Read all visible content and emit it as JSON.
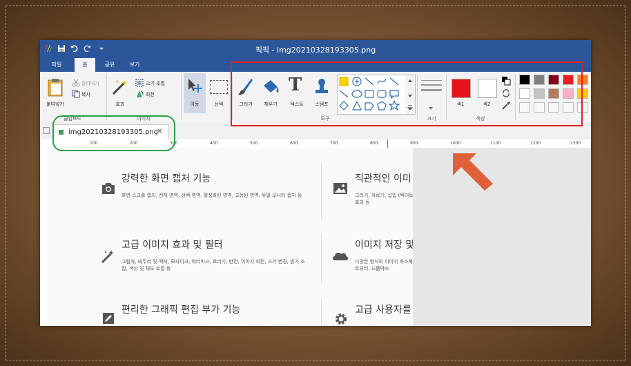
{
  "window": {
    "title": "픽픽 - img20210328193305.png"
  },
  "menu_tabs": [
    "파일",
    "홈",
    "공유",
    "보기"
  ],
  "ribbon": {
    "paste_label": "붙여넣기",
    "cut_label": "잘라내기",
    "copy_label": "복사",
    "effects_label": "효과",
    "resize_label": "크기 조절",
    "rotate_label": "회전",
    "move_label": "이동",
    "select_label": "선택",
    "draw_label": "그리기",
    "fill_label": "채우기",
    "text_label": "텍스트",
    "stamp_label": "스탬프",
    "size_label": "크기",
    "color1_label": "색1",
    "color2_label": "색2",
    "groups": {
      "clipboard": "클립보드",
      "image": "이미지",
      "tools": "도구",
      "size": "크기",
      "colors": "색상"
    },
    "color1": "#e8141c",
    "color2": "#ffffff",
    "palette": [
      "#000000",
      "#7f7f7f",
      "#880015",
      "#ed1c24",
      "#ff7f27",
      "#ffffff",
      "#c3c3c3",
      "#b97a57",
      "#ffaec9",
      "#ffc90e"
    ]
  },
  "document_tab": {
    "filename": "img20210328193305.png",
    "close_symbol": "✕"
  },
  "ruler_ticks": [
    "100",
    "200",
    "300",
    "400",
    "500",
    "600",
    "700",
    "800",
    "900",
    "1000",
    "1100",
    "1200",
    "1300"
  ],
  "features": [
    {
      "icon": "camera-icon",
      "title": "강력한 화면 캡처 기능",
      "desc": "화면 스크롤 캡처, 전체 영역, 선택 영역, 활성화된 영역, 고정된 영역, 듀얼 모니터 캡처 등"
    },
    {
      "icon": "image-icon",
      "title": "직관적인 이미",
      "desc": "그리기, 자르기, 삽입 (텍이트 효과 등"
    },
    {
      "icon": "magic-wand-icon",
      "title": "고급 이미지 효과 및 필터",
      "desc": "그림자, 테두리 및 액자, 모자이크, 워터마크, 흐리기, 반전, 이미지 회전, 크기 변경, 밝기 조절, 색상 및 채도 조절 등"
    },
    {
      "icon": "cloud-icon",
      "title": "이미지 저장 및",
      "desc": "다양한 형식의 이미지 파스북, 트위터, 드롭박스"
    },
    {
      "icon": "pencil-icon",
      "title": "편리한 그래픽 편집 부가 기능",
      "desc": ""
    },
    {
      "icon": "gear-icon",
      "title": "고급 사용자를",
      "desc": ""
    }
  ],
  "colors": {
    "titlebar": "#2b579a",
    "annotation_red": "#e02020",
    "annotation_green": "#25a244",
    "arrow": "#e0603a"
  }
}
